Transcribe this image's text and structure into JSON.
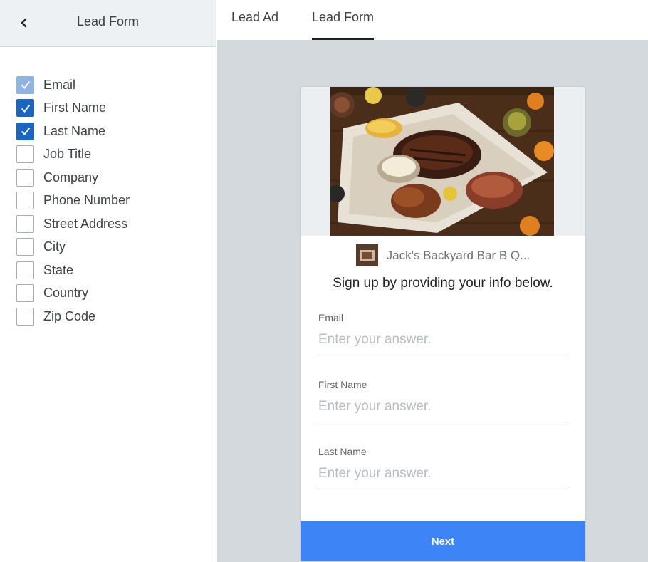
{
  "sidebar": {
    "title": "Lead Form",
    "back_icon": "chevron-left-icon",
    "fields": [
      {
        "label": "Email",
        "state": "checked-disabled"
      },
      {
        "label": "First Name",
        "state": "checked"
      },
      {
        "label": "Last Name",
        "state": "checked"
      },
      {
        "label": "Job Title",
        "state": "unchecked"
      },
      {
        "label": "Company",
        "state": "unchecked"
      },
      {
        "label": "Phone Number",
        "state": "unchecked"
      },
      {
        "label": "Street Address",
        "state": "unchecked"
      },
      {
        "label": "City",
        "state": "unchecked"
      },
      {
        "label": "State",
        "state": "unchecked"
      },
      {
        "label": "Country",
        "state": "unchecked"
      },
      {
        "label": "Zip Code",
        "state": "unchecked"
      }
    ]
  },
  "tabs": [
    {
      "label": "Lead Ad",
      "active": false
    },
    {
      "label": "Lead Form",
      "active": true
    }
  ],
  "preview": {
    "brand_name": "Jack's Backyard Bar B Q...",
    "tagline": "Sign up by providing your info below.",
    "questions": [
      {
        "label": "Email",
        "placeholder": "Enter your answer."
      },
      {
        "label": "First Name",
        "placeholder": "Enter your answer."
      },
      {
        "label": "Last Name",
        "placeholder": "Enter your answer."
      }
    ],
    "next_label": "Next"
  },
  "colors": {
    "checkbox_checked": "#1a65c2",
    "checkbox_disabled": "#8fb3e3",
    "next_button": "#3d84f6",
    "canvas_bg": "#d4d9de"
  }
}
